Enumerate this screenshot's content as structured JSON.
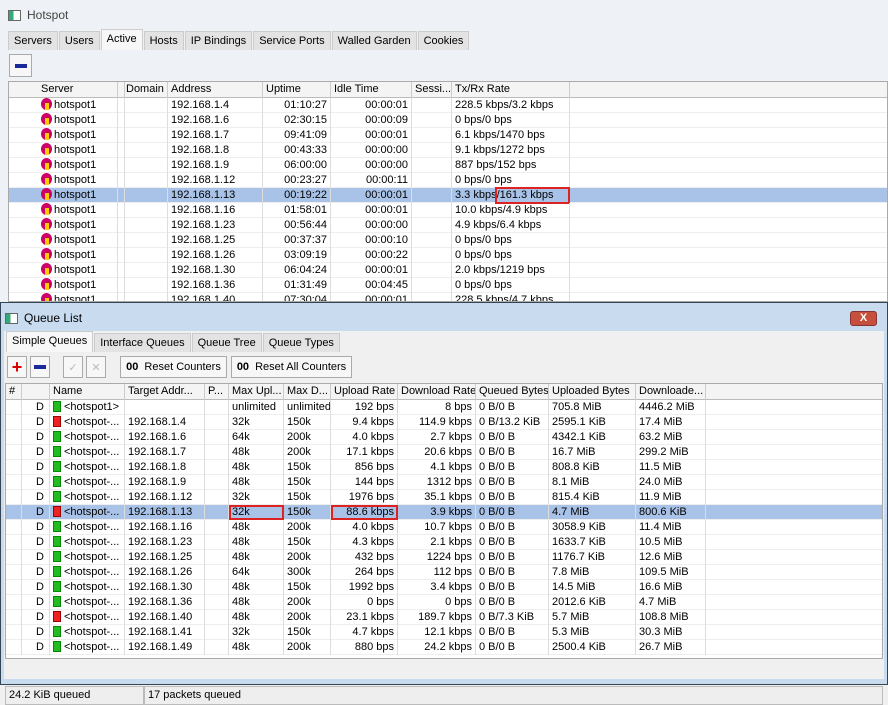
{
  "hotspot": {
    "title": "Hotspot",
    "tabs": [
      "Servers",
      "Users",
      "Active",
      "Hosts",
      "IP Bindings",
      "Service Ports",
      "Walled Garden",
      "Cookies"
    ],
    "active_tab": 2,
    "columns": [
      "Server",
      "",
      "Domain",
      "Address",
      "Uptime",
      "Idle Time",
      "Sessi...",
      "Tx/Rx Rate"
    ],
    "rows": [
      [
        "hotspot1",
        "192.168.1.4",
        "01:10:27",
        "00:00:01",
        "228.5 kbps/3.2 kbps"
      ],
      [
        "hotspot1",
        "192.168.1.6",
        "02:30:15",
        "00:00:09",
        "0 bps/0 bps"
      ],
      [
        "hotspot1",
        "192.168.1.7",
        "09:41:09",
        "00:00:01",
        "6.1 kbps/1470 bps"
      ],
      [
        "hotspot1",
        "192.168.1.8",
        "00:43:33",
        "00:00:00",
        "9.1 kbps/1272 bps"
      ],
      [
        "hotspot1",
        "192.168.1.9",
        "06:00:00",
        "00:00:00",
        "887 bps/152 bps"
      ],
      [
        "hotspot1",
        "192.168.1.12",
        "00:23:27",
        "00:00:11",
        "0 bps/0 bps"
      ],
      [
        "hotspot1",
        "192.168.1.13",
        "00:19:22",
        "00:00:01",
        "3.3 kbps/161.3 kbps"
      ],
      [
        "hotspot1",
        "192.168.1.16",
        "01:58:01",
        "00:00:01",
        "10.0 kbps/4.9 kbps"
      ],
      [
        "hotspot1",
        "192.168.1.23",
        "00:56:44",
        "00:00:00",
        "4.9 kbps/6.4 kbps"
      ],
      [
        "hotspot1",
        "192.168.1.25",
        "00:37:37",
        "00:00:10",
        "0 bps/0 bps"
      ],
      [
        "hotspot1",
        "192.168.1.26",
        "03:09:19",
        "00:00:22",
        "0 bps/0 bps"
      ],
      [
        "hotspot1",
        "192.168.1.30",
        "06:04:24",
        "00:00:01",
        "2.0 kbps/1219 bps"
      ],
      [
        "hotspot1",
        "192.168.1.36",
        "01:31:49",
        "00:04:45",
        "0 bps/0 bps"
      ],
      [
        "hotspot1",
        "192.168.1.40",
        "07:30:04",
        "00:00:01",
        "228.5 kbps/4.7 kbps"
      ]
    ],
    "selected_row": 6
  },
  "queue": {
    "title": "Queue List",
    "close": "X",
    "tabs": [
      "Simple Queues",
      "Interface Queues",
      "Queue Tree",
      "Queue Types"
    ],
    "active_tab": 0,
    "reset_counters": "Reset Counters",
    "reset_all_counters": "Reset All Counters",
    "counter_icon": "00",
    "columns": [
      "#",
      "",
      "Name",
      "Target Addr...",
      "P...",
      "Max Upl...",
      "Max D...",
      "Upload Rate",
      "Download Rate",
      "Queued Bytes",
      "Uploaded Bytes",
      "Downloade..."
    ],
    "rows": [
      [
        "D",
        "green",
        "<hotspot1>",
        "",
        "unlimited",
        "unlimited",
        "192 bps",
        "8 bps",
        "0 B/0 B",
        "705.8 MiB",
        "4446.2 MiB"
      ],
      [
        "D",
        "red",
        "<hotspot-...",
        "192.168.1.4",
        "32k",
        "150k",
        "9.4 kbps",
        "114.9 kbps",
        "0 B/13.2 KiB",
        "2595.1 KiB",
        "17.4 MiB"
      ],
      [
        "D",
        "green",
        "<hotspot-...",
        "192.168.1.6",
        "64k",
        "200k",
        "4.0 kbps",
        "2.7 kbps",
        "0 B/0 B",
        "4342.1 KiB",
        "63.2 MiB"
      ],
      [
        "D",
        "green",
        "<hotspot-...",
        "192.168.1.7",
        "48k",
        "200k",
        "17.1 kbps",
        "20.6 kbps",
        "0 B/0 B",
        "16.7 MiB",
        "299.2 MiB"
      ],
      [
        "D",
        "green",
        "<hotspot-...",
        "192.168.1.8",
        "48k",
        "150k",
        "856 bps",
        "4.1 kbps",
        "0 B/0 B",
        "808.8 KiB",
        "11.5 MiB"
      ],
      [
        "D",
        "green",
        "<hotspot-...",
        "192.168.1.9",
        "48k",
        "150k",
        "144 bps",
        "1312 bps",
        "0 B/0 B",
        "8.1 MiB",
        "24.0 MiB"
      ],
      [
        "D",
        "green",
        "<hotspot-...",
        "192.168.1.12",
        "32k",
        "150k",
        "1976 bps",
        "35.1 kbps",
        "0 B/0 B",
        "815.4 KiB",
        "11.9 MiB"
      ],
      [
        "D",
        "red",
        "<hotspot-...",
        "192.168.1.13",
        "32k",
        "150k",
        "88.6 kbps",
        "3.9 kbps",
        "0 B/0 B",
        "4.7 MiB",
        "800.6 KiB"
      ],
      [
        "D",
        "green",
        "<hotspot-...",
        "192.168.1.16",
        "48k",
        "200k",
        "4.0 kbps",
        "10.7 kbps",
        "0 B/0 B",
        "3058.9 KiB",
        "11.4 MiB"
      ],
      [
        "D",
        "green",
        "<hotspot-...",
        "192.168.1.23",
        "48k",
        "150k",
        "4.3 kbps",
        "2.1 kbps",
        "0 B/0 B",
        "1633.7 KiB",
        "10.5 MiB"
      ],
      [
        "D",
        "green",
        "<hotspot-...",
        "192.168.1.25",
        "48k",
        "200k",
        "432 bps",
        "1224 bps",
        "0 B/0 B",
        "1176.7 KiB",
        "12.6 MiB"
      ],
      [
        "D",
        "green",
        "<hotspot-...",
        "192.168.1.26",
        "64k",
        "300k",
        "264 bps",
        "112 bps",
        "0 B/0 B",
        "7.8 MiB",
        "109.5 MiB"
      ],
      [
        "D",
        "green",
        "<hotspot-...",
        "192.168.1.30",
        "48k",
        "150k",
        "1992 bps",
        "3.4 kbps",
        "0 B/0 B",
        "14.5 MiB",
        "16.6 MiB"
      ],
      [
        "D",
        "green",
        "<hotspot-...",
        "192.168.1.36",
        "48k",
        "200k",
        "0 bps",
        "0 bps",
        "0 B/0 B",
        "2012.6 KiB",
        "4.7 MiB"
      ],
      [
        "D",
        "red",
        "<hotspot-...",
        "192.168.1.40",
        "48k",
        "200k",
        "23.1 kbps",
        "189.7 kbps",
        "0 B/7.3 KiB",
        "5.7 MiB",
        "108.8 MiB"
      ],
      [
        "D",
        "green",
        "<hotspot-...",
        "192.168.1.41",
        "32k",
        "150k",
        "4.7 kbps",
        "12.1 kbps",
        "0 B/0 B",
        "5.3 MiB",
        "30.3 MiB"
      ],
      [
        "D",
        "green",
        "<hotspot-...",
        "192.168.1.49",
        "48k",
        "200k",
        "880 bps",
        "24.2 kbps",
        "0 B/0 B",
        "2500.4 KiB",
        "26.7 MiB"
      ]
    ],
    "selected_row": 7,
    "status": [
      "24.2 KiB queued",
      "17 packets queued"
    ]
  }
}
